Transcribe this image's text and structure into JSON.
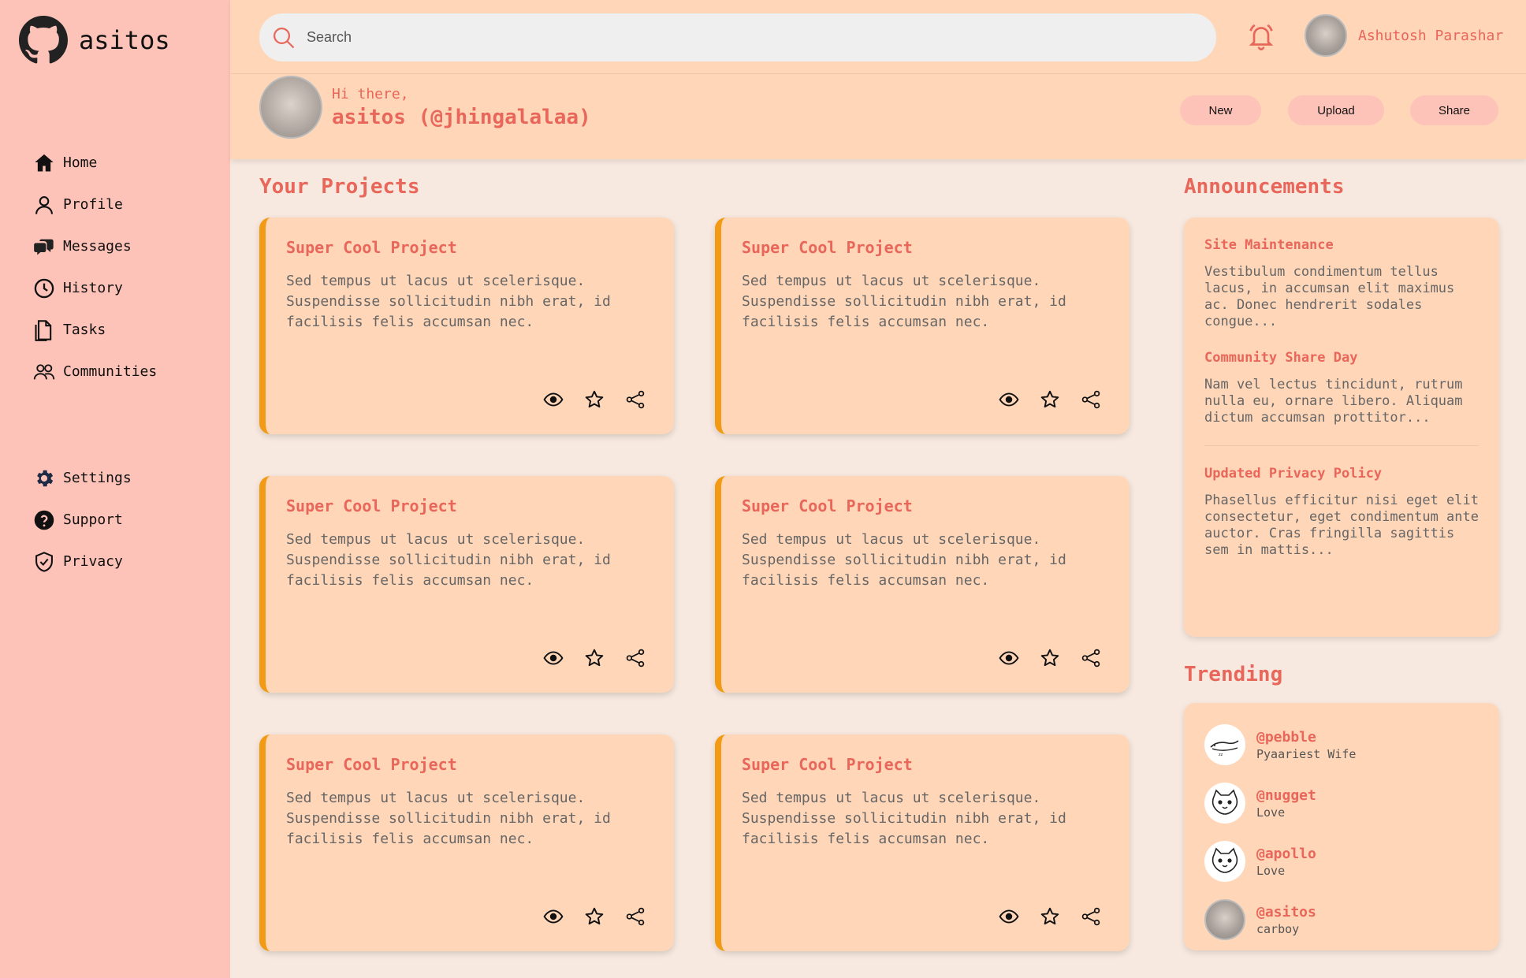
{
  "brand": {
    "name": "asitos"
  },
  "sidebar": {
    "top_items": [
      {
        "label": "Home",
        "icon": "home-icon"
      },
      {
        "label": "Profile",
        "icon": "user-icon"
      },
      {
        "label": "Messages",
        "icon": "chat-icon"
      },
      {
        "label": "History",
        "icon": "clock-icon"
      },
      {
        "label": "Tasks",
        "icon": "document-icon"
      },
      {
        "label": "Communities",
        "icon": "people-icon"
      }
    ],
    "bottom_items": [
      {
        "label": "Settings",
        "icon": "gear-icon"
      },
      {
        "label": "Support",
        "icon": "help-icon"
      },
      {
        "label": "Privacy",
        "icon": "shield-icon"
      }
    ]
  },
  "header": {
    "search_placeholder": "Search",
    "user_name": "Ashutosh Parashar",
    "greeting": "Hi there,",
    "handle": "asitos (@jhingalalaa)",
    "buttons": {
      "new": "New",
      "upload": "Upload",
      "share": "Share"
    }
  },
  "projects": {
    "title": "Your Projects",
    "items": [
      {
        "title": "Super Cool Project",
        "desc": "Sed tempus ut lacus ut scelerisque. Suspendisse sollicitudin nibh erat, id facilisis felis accumsan nec."
      },
      {
        "title": "Super Cool Project",
        "desc": "Sed tempus ut lacus ut scelerisque. Suspendisse sollicitudin nibh erat, id facilisis felis accumsan nec."
      },
      {
        "title": "Super Cool Project",
        "desc": "Sed tempus ut lacus ut scelerisque. Suspendisse sollicitudin nibh erat, id facilisis felis accumsan nec."
      },
      {
        "title": "Super Cool Project",
        "desc": "Sed tempus ut lacus ut scelerisque. Suspendisse sollicitudin nibh erat, id facilisis felis accumsan nec."
      },
      {
        "title": "Super Cool Project",
        "desc": "Sed tempus ut lacus ut scelerisque. Suspendisse sollicitudin nibh erat, id facilisis felis accumsan nec."
      },
      {
        "title": "Super Cool Project",
        "desc": "Sed tempus ut lacus ut scelerisque. Suspendisse sollicitudin nibh erat, id facilisis felis accumsan nec."
      }
    ]
  },
  "announcements": {
    "title": "Announcements",
    "items": [
      {
        "title": "Site Maintenance",
        "desc": "Vestibulum condimentum tellus lacus, in accumsan elit maximus ac. Donec hendrerit sodales congue..."
      },
      {
        "title": "Community Share Day",
        "desc": "Nam vel lectus tincidunt, rutrum nulla eu, ornare libero. Aliquam dictum accumsan prottitor..."
      },
      {
        "title": "Updated Privacy Policy",
        "desc": "Phasellus efficitur nisi eget elit consectetur, eget condimentum ante auctor. Cras fringilla sagittis sem in mattis..."
      }
    ]
  },
  "trending": {
    "title": "Trending",
    "items": [
      {
        "handle": "@pebble",
        "sub": "Pyaariest Wife"
      },
      {
        "handle": "@nugget",
        "sub": "Love"
      },
      {
        "handle": "@apollo",
        "sub": "Love"
      },
      {
        "handle": "@asitos",
        "sub": "carboy"
      }
    ]
  },
  "colors": {
    "accent": "#e8665a",
    "sidebar": "#fec3b8",
    "header": "#ffd6b8",
    "card_border": "#f39a14",
    "background": "#f7e9df"
  }
}
